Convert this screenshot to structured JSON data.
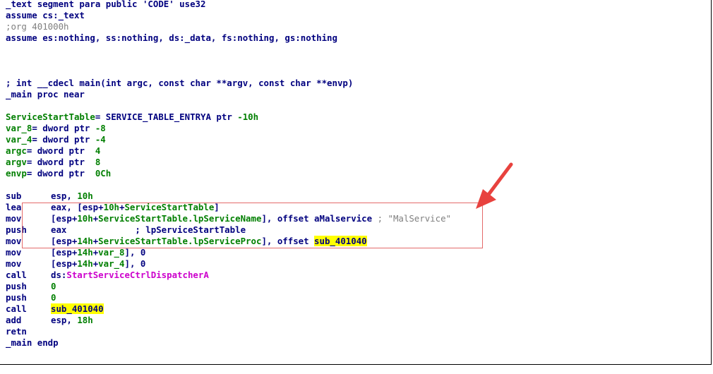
{
  "segment": {
    "l1": "_text segment para public 'CODE' use32",
    "l2": "assume cs:_text",
    "l3": ";org 401000h",
    "l4": "assume es:nothing, ss:nothing, ds:_data, fs:nothing, gs:nothing"
  },
  "proto": {
    "comment": "; int __cdecl main(int argc, const char **argv, const char **envp)",
    "proc": "_main proc near"
  },
  "vars": [
    {
      "name": "ServiceStartTable",
      "rest": "= SERVICE_TABLE_ENTRYA ptr ",
      "off": "-10h"
    },
    {
      "name": "var_8",
      "rest": "= dword ptr ",
      "off": "-8"
    },
    {
      "name": "var_4",
      "rest": "= dword ptr ",
      "off": "-4"
    },
    {
      "name": "argc",
      "rest": "= dword ptr  ",
      "off": "4"
    },
    {
      "name": "argv",
      "rest": "= dword ptr  ",
      "off": "8"
    },
    {
      "name": "envp",
      "rest": "= dword ptr  ",
      "off": "0Ch"
    }
  ],
  "insn": {
    "sub": "sub",
    "lea": "lea",
    "mov": "mov",
    "push": "push",
    "call": "call",
    "add": "add",
    "retn": "retn"
  },
  "ops": {
    "esp_comma": "esp, ",
    "v10h": "10h",
    "eax_lb": "eax, [esp+",
    "lb_esp": "[esp+",
    "v14h": "14h",
    "plus": "+",
    "sst": "ServiceStartTable",
    "rb": "]",
    "lpname": ".lpServiceName",
    "lpproc": ".lpServiceProc",
    "off_sep": "], offset ",
    "amal": "aMalservice",
    "amal_comment": " ; \"MalService\"",
    "eax": "eax",
    "push_comment": "             ; lpServiceStartTable",
    "var_8": "var_8",
    "var_4": "var_4",
    "zero_tail": "], 0",
    "sub_401040": "sub_401040",
    "ds": "ds:",
    "dispatcher": "StartServiceCtrlDispatcherA",
    "zero": "0",
    "v18h": "18h"
  },
  "endp": "_main endp",
  "colors": {
    "code": "#00007f",
    "offset": "#007f00",
    "api": "#cc00cc",
    "string": "#7f7f7f",
    "highlight": "#ffff00",
    "annotation": "#e8423e"
  }
}
